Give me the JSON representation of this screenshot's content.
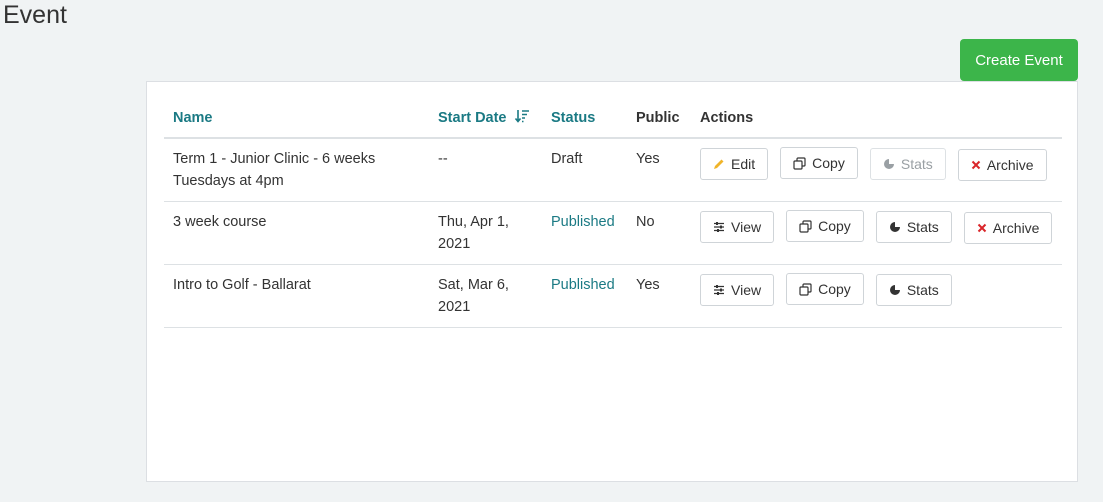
{
  "page": {
    "title": "Event"
  },
  "toolbar": {
    "create_label": "Create Event"
  },
  "colors": {
    "accent": "#1b7a84",
    "create": "#3cb54a",
    "archive_x": "#d9262a",
    "edit_pencil": "#f0b429"
  },
  "table": {
    "headers": {
      "name": "Name",
      "start_date": "Start Date",
      "status": "Status",
      "public": "Public",
      "actions": "Actions"
    },
    "rows": [
      {
        "name_line1": "Term 1 - Junior Clinic - 6 weeks",
        "name_line2": "Tuesdays at 4pm",
        "date_line1": "--",
        "date_line2": "",
        "status": "Draft",
        "public": "Yes",
        "actions": {
          "primary": "Edit",
          "copy": "Copy",
          "stats": "Stats",
          "archive": "Archive"
        }
      },
      {
        "name_line1": "3 week course",
        "name_line2": "",
        "date_line1": "Thu, Apr 1,",
        "date_line2": "2021",
        "status": "Published",
        "public": "No",
        "actions": {
          "primary": "View",
          "copy": "Copy",
          "stats": "Stats",
          "archive": "Archive"
        }
      },
      {
        "name_line1": "Intro to Golf - Ballarat",
        "name_line2": "",
        "date_line1": "Sat, Mar 6,",
        "date_line2": "2021",
        "status": "Published",
        "public": "Yes",
        "actions": {
          "primary": "View",
          "copy": "Copy",
          "stats": "Stats"
        }
      }
    ]
  }
}
